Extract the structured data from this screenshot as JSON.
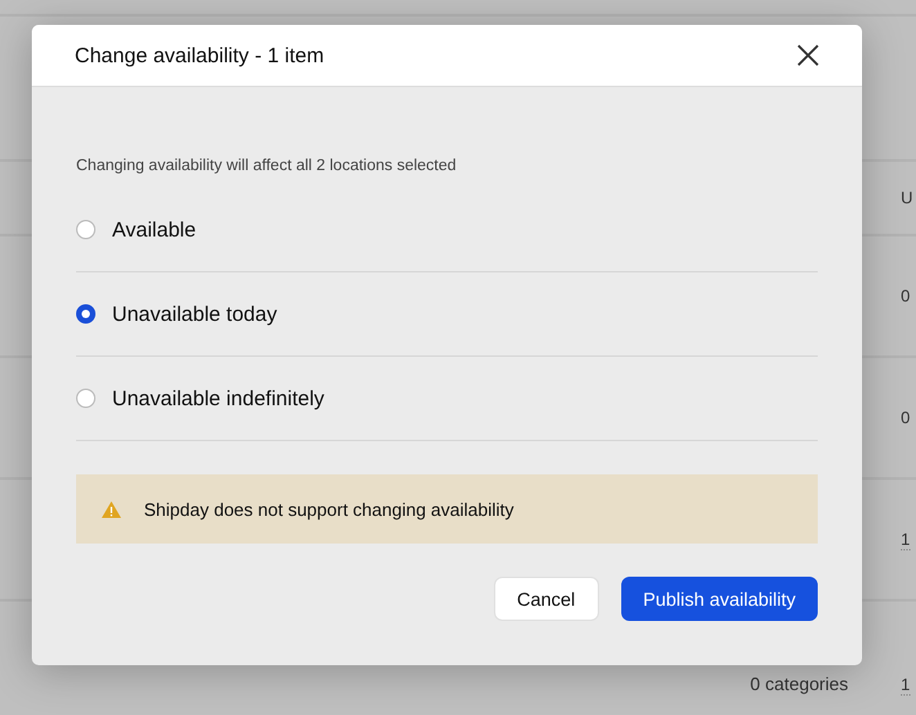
{
  "background_table": {
    "header": "U",
    "rows": [
      {
        "column_1": "",
        "column_2": "0"
      },
      {
        "column_1": "",
        "column_2": "0"
      },
      {
        "column_1": "",
        "column_2": "1"
      },
      {
        "column_1": "0 categories",
        "column_2": "1"
      }
    ]
  },
  "dialog": {
    "title": "Change availability - 1 item",
    "description": "Changing availability will affect all 2 locations selected",
    "options": [
      {
        "label": "Available",
        "selected": false
      },
      {
        "label": "Unavailable today",
        "selected": true
      },
      {
        "label": "Unavailable indefinitely",
        "selected": false
      }
    ],
    "warning": "Shipday does not support changing availability",
    "buttons": [
      {
        "label": "Cancel",
        "kind": "secondary"
      },
      {
        "label": "Publish availability",
        "kind": "primary"
      }
    ]
  }
}
